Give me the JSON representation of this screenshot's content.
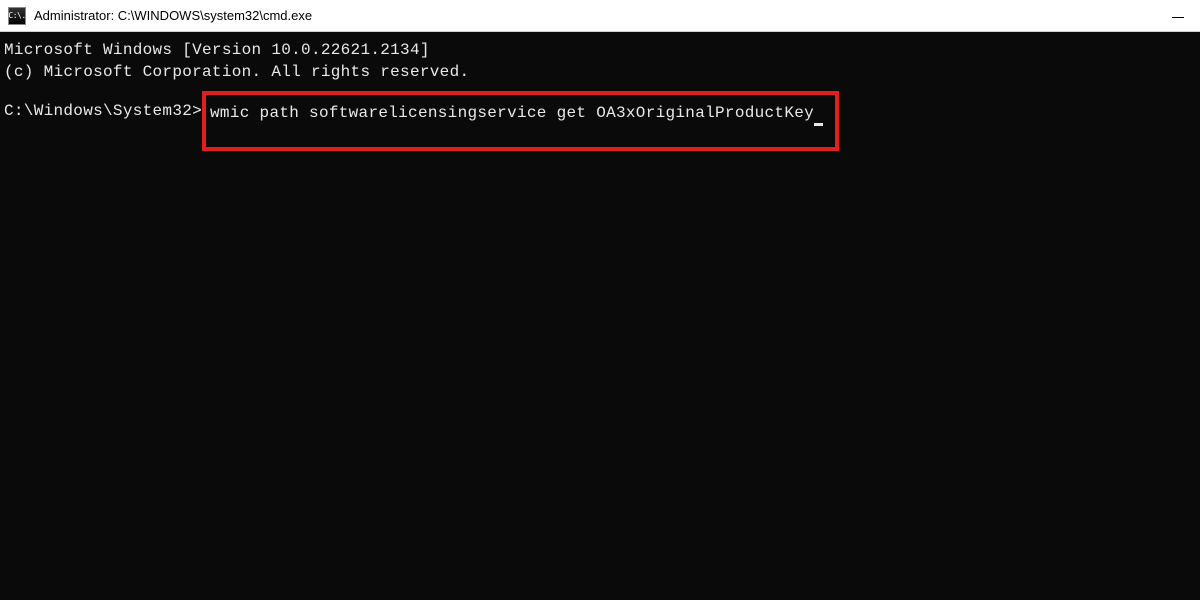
{
  "window": {
    "title": "Administrator: C:\\WINDOWS\\system32\\cmd.exe",
    "icon_label": "C:\\."
  },
  "terminal": {
    "banner_line1": "Microsoft Windows [Version 10.0.22621.2134]",
    "banner_line2": "(c) Microsoft Corporation. All rights reserved.",
    "prompt": "C:\\Windows\\System32>",
    "command": "wmic path softwarelicensingservice get OA3xOriginalProductKey"
  },
  "highlight": {
    "color": "#e02020"
  }
}
